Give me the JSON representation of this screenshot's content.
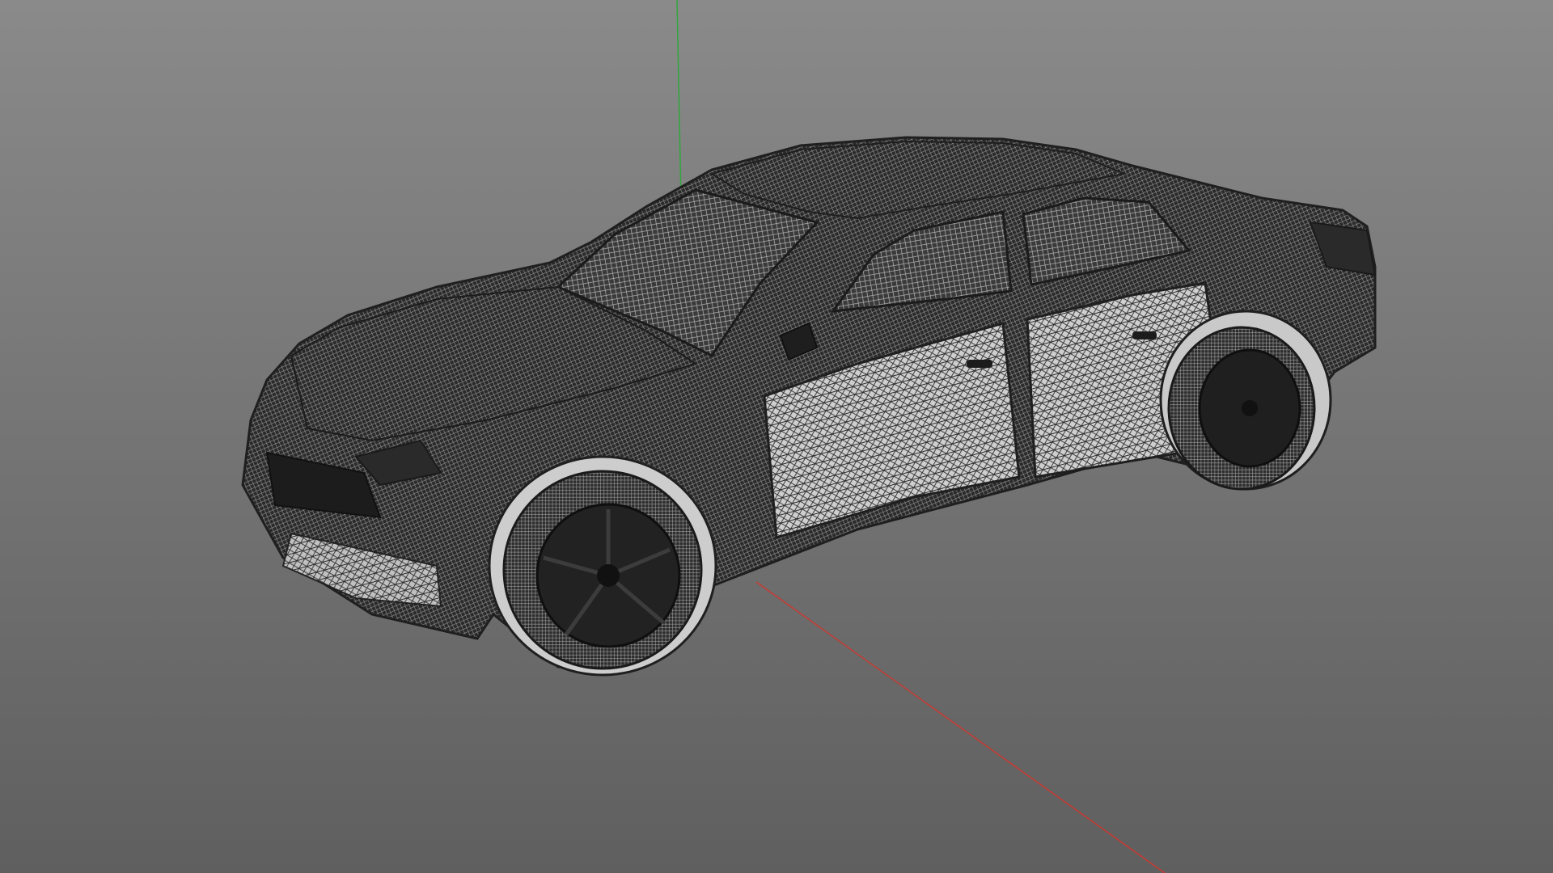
{
  "viewport": {
    "background_top": "#8a8a8a",
    "background_bottom": "#5f5f5f"
  },
  "model": {
    "render_mode": "wireframe",
    "object": "sedan car mesh",
    "wire_color": "#262626",
    "facet_color": "#d8d8d8"
  },
  "axes": {
    "x_axis_color": "#c83a32",
    "y_axis_color": "#2fa83c"
  }
}
